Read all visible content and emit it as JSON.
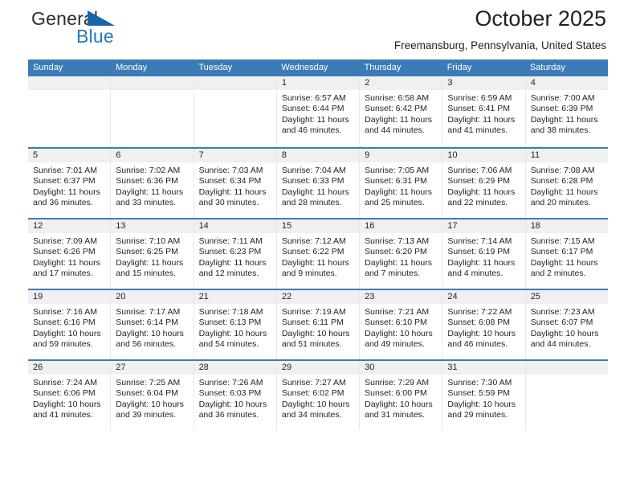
{
  "logo": {
    "word_top": "General",
    "word_bottom": "Blue",
    "flag_icon": "blue-flag-triangle-icon",
    "top_color": "#2d2d2d",
    "bottom_color": "#1e7ac4"
  },
  "header": {
    "title": "October 2025",
    "location": "Freemansburg, Pennsylvania, United States"
  },
  "theme": {
    "header_bg": "#3b7cb8",
    "header_text": "#ffffff",
    "daynum_bg": "#f0f0f0",
    "cell_border": "#e8e8e8"
  },
  "weekdays": [
    "Sunday",
    "Monday",
    "Tuesday",
    "Wednesday",
    "Thursday",
    "Friday",
    "Saturday"
  ],
  "weeks": [
    [
      {
        "day": "",
        "empty": true,
        "sunrise": "",
        "sunset": "",
        "daylight1": "",
        "daylight2": ""
      },
      {
        "day": "",
        "empty": true,
        "sunrise": "",
        "sunset": "",
        "daylight1": "",
        "daylight2": ""
      },
      {
        "day": "",
        "empty": true,
        "sunrise": "",
        "sunset": "",
        "daylight1": "",
        "daylight2": ""
      },
      {
        "day": "1",
        "empty": false,
        "sunrise": "Sunrise: 6:57 AM",
        "sunset": "Sunset: 6:44 PM",
        "daylight1": "Daylight: 11 hours",
        "daylight2": "and 46 minutes."
      },
      {
        "day": "2",
        "empty": false,
        "sunrise": "Sunrise: 6:58 AM",
        "sunset": "Sunset: 6:42 PM",
        "daylight1": "Daylight: 11 hours",
        "daylight2": "and 44 minutes."
      },
      {
        "day": "3",
        "empty": false,
        "sunrise": "Sunrise: 6:59 AM",
        "sunset": "Sunset: 6:41 PM",
        "daylight1": "Daylight: 11 hours",
        "daylight2": "and 41 minutes."
      },
      {
        "day": "4",
        "empty": false,
        "sunrise": "Sunrise: 7:00 AM",
        "sunset": "Sunset: 6:39 PM",
        "daylight1": "Daylight: 11 hours",
        "daylight2": "and 38 minutes."
      }
    ],
    [
      {
        "day": "5",
        "empty": false,
        "sunrise": "Sunrise: 7:01 AM",
        "sunset": "Sunset: 6:37 PM",
        "daylight1": "Daylight: 11 hours",
        "daylight2": "and 36 minutes."
      },
      {
        "day": "6",
        "empty": false,
        "sunrise": "Sunrise: 7:02 AM",
        "sunset": "Sunset: 6:36 PM",
        "daylight1": "Daylight: 11 hours",
        "daylight2": "and 33 minutes."
      },
      {
        "day": "7",
        "empty": false,
        "sunrise": "Sunrise: 7:03 AM",
        "sunset": "Sunset: 6:34 PM",
        "daylight1": "Daylight: 11 hours",
        "daylight2": "and 30 minutes."
      },
      {
        "day": "8",
        "empty": false,
        "sunrise": "Sunrise: 7:04 AM",
        "sunset": "Sunset: 6:33 PM",
        "daylight1": "Daylight: 11 hours",
        "daylight2": "and 28 minutes."
      },
      {
        "day": "9",
        "empty": false,
        "sunrise": "Sunrise: 7:05 AM",
        "sunset": "Sunset: 6:31 PM",
        "daylight1": "Daylight: 11 hours",
        "daylight2": "and 25 minutes."
      },
      {
        "day": "10",
        "empty": false,
        "sunrise": "Sunrise: 7:06 AM",
        "sunset": "Sunset: 6:29 PM",
        "daylight1": "Daylight: 11 hours",
        "daylight2": "and 22 minutes."
      },
      {
        "day": "11",
        "empty": false,
        "sunrise": "Sunrise: 7:08 AM",
        "sunset": "Sunset: 6:28 PM",
        "daylight1": "Daylight: 11 hours",
        "daylight2": "and 20 minutes."
      }
    ],
    [
      {
        "day": "12",
        "empty": false,
        "sunrise": "Sunrise: 7:09 AM",
        "sunset": "Sunset: 6:26 PM",
        "daylight1": "Daylight: 11 hours",
        "daylight2": "and 17 minutes."
      },
      {
        "day": "13",
        "empty": false,
        "sunrise": "Sunrise: 7:10 AM",
        "sunset": "Sunset: 6:25 PM",
        "daylight1": "Daylight: 11 hours",
        "daylight2": "and 15 minutes."
      },
      {
        "day": "14",
        "empty": false,
        "sunrise": "Sunrise: 7:11 AM",
        "sunset": "Sunset: 6:23 PM",
        "daylight1": "Daylight: 11 hours",
        "daylight2": "and 12 minutes."
      },
      {
        "day": "15",
        "empty": false,
        "sunrise": "Sunrise: 7:12 AM",
        "sunset": "Sunset: 6:22 PM",
        "daylight1": "Daylight: 11 hours",
        "daylight2": "and 9 minutes."
      },
      {
        "day": "16",
        "empty": false,
        "sunrise": "Sunrise: 7:13 AM",
        "sunset": "Sunset: 6:20 PM",
        "daylight1": "Daylight: 11 hours",
        "daylight2": "and 7 minutes."
      },
      {
        "day": "17",
        "empty": false,
        "sunrise": "Sunrise: 7:14 AM",
        "sunset": "Sunset: 6:19 PM",
        "daylight1": "Daylight: 11 hours",
        "daylight2": "and 4 minutes."
      },
      {
        "day": "18",
        "empty": false,
        "sunrise": "Sunrise: 7:15 AM",
        "sunset": "Sunset: 6:17 PM",
        "daylight1": "Daylight: 11 hours",
        "daylight2": "and 2 minutes."
      }
    ],
    [
      {
        "day": "19",
        "empty": false,
        "sunrise": "Sunrise: 7:16 AM",
        "sunset": "Sunset: 6:16 PM",
        "daylight1": "Daylight: 10 hours",
        "daylight2": "and 59 minutes."
      },
      {
        "day": "20",
        "empty": false,
        "sunrise": "Sunrise: 7:17 AM",
        "sunset": "Sunset: 6:14 PM",
        "daylight1": "Daylight: 10 hours",
        "daylight2": "and 56 minutes."
      },
      {
        "day": "21",
        "empty": false,
        "sunrise": "Sunrise: 7:18 AM",
        "sunset": "Sunset: 6:13 PM",
        "daylight1": "Daylight: 10 hours",
        "daylight2": "and 54 minutes."
      },
      {
        "day": "22",
        "empty": false,
        "sunrise": "Sunrise: 7:19 AM",
        "sunset": "Sunset: 6:11 PM",
        "daylight1": "Daylight: 10 hours",
        "daylight2": "and 51 minutes."
      },
      {
        "day": "23",
        "empty": false,
        "sunrise": "Sunrise: 7:21 AM",
        "sunset": "Sunset: 6:10 PM",
        "daylight1": "Daylight: 10 hours",
        "daylight2": "and 49 minutes."
      },
      {
        "day": "24",
        "empty": false,
        "sunrise": "Sunrise: 7:22 AM",
        "sunset": "Sunset: 6:08 PM",
        "daylight1": "Daylight: 10 hours",
        "daylight2": "and 46 minutes."
      },
      {
        "day": "25",
        "empty": false,
        "sunrise": "Sunrise: 7:23 AM",
        "sunset": "Sunset: 6:07 PM",
        "daylight1": "Daylight: 10 hours",
        "daylight2": "and 44 minutes."
      }
    ],
    [
      {
        "day": "26",
        "empty": false,
        "sunrise": "Sunrise: 7:24 AM",
        "sunset": "Sunset: 6:06 PM",
        "daylight1": "Daylight: 10 hours",
        "daylight2": "and 41 minutes."
      },
      {
        "day": "27",
        "empty": false,
        "sunrise": "Sunrise: 7:25 AM",
        "sunset": "Sunset: 6:04 PM",
        "daylight1": "Daylight: 10 hours",
        "daylight2": "and 39 minutes."
      },
      {
        "day": "28",
        "empty": false,
        "sunrise": "Sunrise: 7:26 AM",
        "sunset": "Sunset: 6:03 PM",
        "daylight1": "Daylight: 10 hours",
        "daylight2": "and 36 minutes."
      },
      {
        "day": "29",
        "empty": false,
        "sunrise": "Sunrise: 7:27 AM",
        "sunset": "Sunset: 6:02 PM",
        "daylight1": "Daylight: 10 hours",
        "daylight2": "and 34 minutes."
      },
      {
        "day": "30",
        "empty": false,
        "sunrise": "Sunrise: 7:29 AM",
        "sunset": "Sunset: 6:00 PM",
        "daylight1": "Daylight: 10 hours",
        "daylight2": "and 31 minutes."
      },
      {
        "day": "31",
        "empty": false,
        "sunrise": "Sunrise: 7:30 AM",
        "sunset": "Sunset: 5:59 PM",
        "daylight1": "Daylight: 10 hours",
        "daylight2": "and 29 minutes."
      },
      {
        "day": "",
        "empty": true,
        "sunrise": "",
        "sunset": "",
        "daylight1": "",
        "daylight2": ""
      }
    ]
  ]
}
